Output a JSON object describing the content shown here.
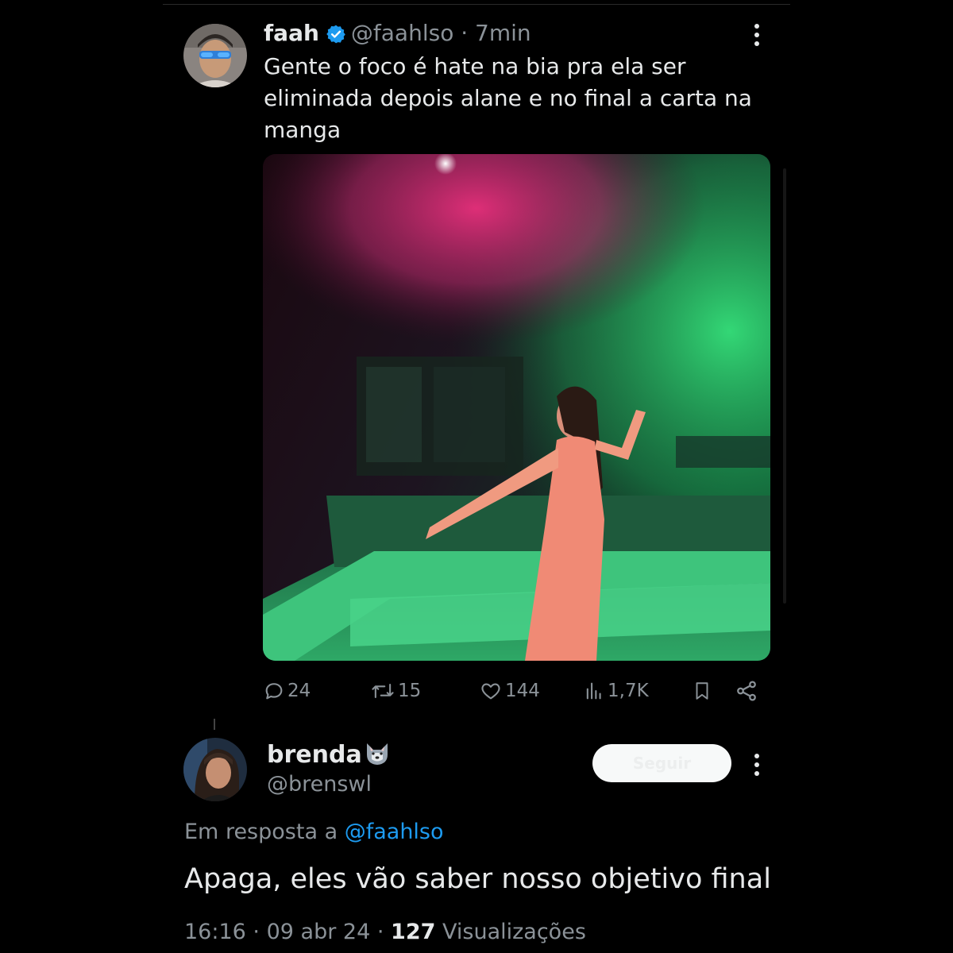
{
  "tweet": {
    "author_name": "faah",
    "handle": "@faahlso",
    "separator": "·",
    "time": "7min",
    "text": "Gente o foco é hate na bia pra ela ser eliminada depois alane e no final a carta na manga",
    "media_icon": "speaker-icon"
  },
  "actions": {
    "replies": "24",
    "reposts": "15",
    "likes": "144",
    "views": "1,7K"
  },
  "reply": {
    "author_name": "brenda",
    "author_emoji": "wolf-emoji",
    "handle": "@brenswl",
    "follow_label": "Seguir",
    "reply_to_prefix": "Em resposta a",
    "reply_to_handle": "@faahlso",
    "text": "Apaga, eles vão saber nosso objetivo final",
    "time": "16:16",
    "date": "09 abr 24",
    "sep1": "·",
    "sep2": "·",
    "view_count": "127",
    "view_label": "Visualizações"
  },
  "colors": {
    "background": "#000000",
    "text": "#e7e9ea",
    "muted": "#8b9298",
    "link": "#1d9bf0",
    "verified": "#1d9bf0"
  }
}
